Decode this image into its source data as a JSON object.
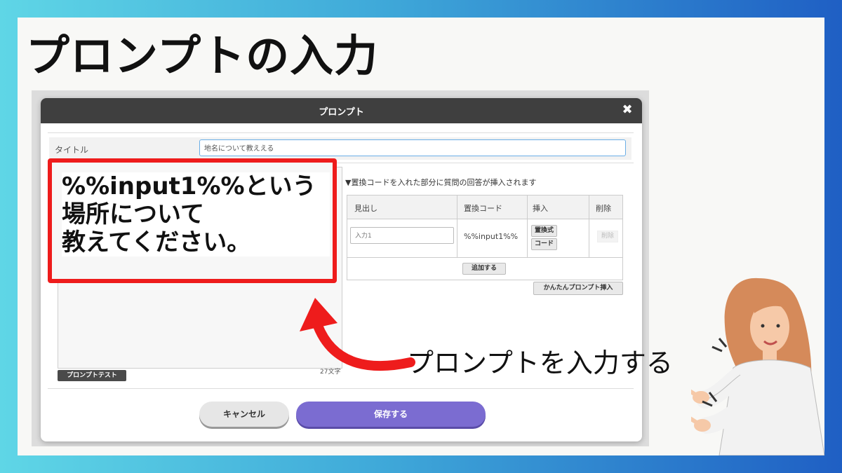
{
  "slide": {
    "heading": "プロンプトの入力",
    "callout_lines": [
      "%%input1%%という",
      "場所について",
      "教えてください。"
    ],
    "annotation": "プロンプトを入力する"
  },
  "modal": {
    "title": "プロンプト",
    "close_icon": "close-icon",
    "title_label": "タイトル",
    "title_value": "地名について教ええる",
    "char_count": "27文字",
    "test_button": "プロンプトテスト",
    "note": "▼置換コードを入れた部分に質問の回答が挿入されます",
    "table": {
      "headers": [
        "見出し",
        "置換コード",
        "挿入",
        "削除"
      ],
      "row": {
        "placeholder": "入力1",
        "code": "%%input1%%",
        "insert_buttons": [
          "置換式",
          "コード"
        ],
        "delete_label": "削除"
      }
    },
    "add_button": "追加する",
    "easy_button": "かんたんプロンプト挿入",
    "cancel_button": "キャンセル",
    "save_button": "保存する"
  },
  "colors": {
    "callout_red": "#ee1c1c",
    "save_purple": "#7b6cd1",
    "header_dark": "#3f3f3f"
  }
}
